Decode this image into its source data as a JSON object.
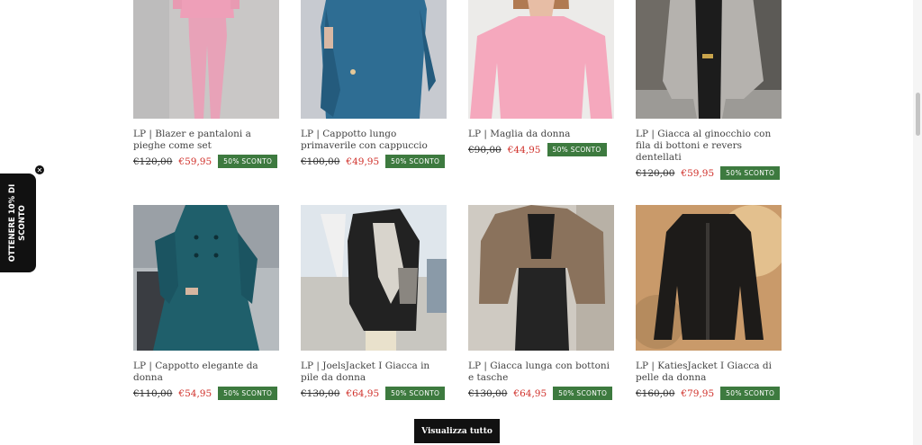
{
  "products": [
    {
      "title": "LP | Blazer e pantaloni a pieghe come set",
      "old_price": "€120,00",
      "new_price": "€59,95",
      "badge": "50% SCONTO"
    },
    {
      "title": "LP | Cappotto lungo primaverile con cappuccio",
      "old_price": "€100,00",
      "new_price": "€49,95",
      "badge": "50% SCONTO"
    },
    {
      "title": "LP | Maglia da donna",
      "old_price": "€90,00",
      "new_price": "€44,95",
      "badge": "50% SCONTO"
    },
    {
      "title": "LP | Giacca al ginocchio con fila di bottoni e revers dentellati",
      "old_price": "€120,00",
      "new_price": "€59,95",
      "badge": "50% SCONTO"
    },
    {
      "title": "LP | Cappotto elegante da donna",
      "old_price": "€110,00",
      "new_price": "€54,95",
      "badge": "50% SCONTO"
    },
    {
      "title": "LP | JoelsJacket I Giacca in pile da donna",
      "old_price": "€130,00",
      "new_price": "€64,95",
      "badge": "50% SCONTO"
    },
    {
      "title": "LP | Giacca lunga con bottoni e tasche",
      "old_price": "€130,00",
      "new_price": "€64,95",
      "badge": "50% SCONTO"
    },
    {
      "title": "LP | KatiesJacket I Giacca di pelle da donna",
      "old_price": "€160,00",
      "new_price": "€79,95",
      "badge": "50% SCONTO"
    }
  ],
  "view_all_label": "Visualizza tutto",
  "promo": {
    "label": "OTTENERE 10% DI SCONTO",
    "close_icon": "close-icon"
  },
  "colors": {
    "badge_green": "#3d7a3f",
    "sale_red": "#d0302a",
    "button_black": "#111111"
  }
}
